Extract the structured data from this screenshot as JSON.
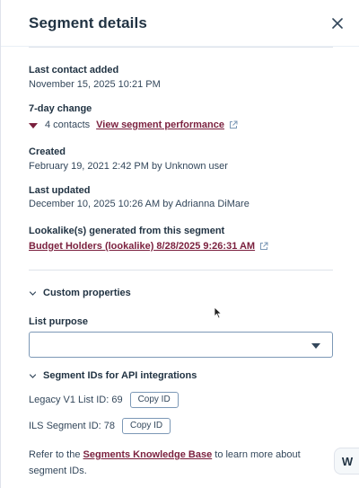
{
  "header": {
    "title": "Segment details"
  },
  "fields": {
    "last_contact_added": {
      "label": "Last contact added",
      "value": "November 15, 2025 10:21 PM"
    },
    "seven_day_change": {
      "label": "7-day change",
      "contacts": "4 contacts",
      "link": "View segment performance"
    },
    "created": {
      "label": "Created",
      "value": "February 19, 2021 2:42 PM by Unknown user"
    },
    "last_updated": {
      "label": "Last updated",
      "value": "December 10, 2025 10:26 AM by Adrianna DiMare"
    },
    "lookalike": {
      "label": "Lookalike(s) generated from this segment",
      "link": "Budget Holders (lookalike) 8/28/2025 9:26:31 AM"
    }
  },
  "custom_properties": {
    "label": "Custom properties"
  },
  "list_purpose": {
    "label": "List purpose",
    "value": ""
  },
  "segment_ids": {
    "label": "Segment IDs for API integrations",
    "legacy_label": "Legacy V1 List ID: 69",
    "ils_label": "ILS Segment ID: 78",
    "copy_label": "Copy ID"
  },
  "kb": {
    "prefix": "Refer to the ",
    "link": "Segments Knowledge Base",
    "suffix": " to learn more about segment IDs."
  },
  "widget": {
    "label": "W"
  },
  "colors": {
    "link": "#7a1f3d",
    "text": "#33475b",
    "heading": "#213343",
    "border": "#7c98b6"
  }
}
